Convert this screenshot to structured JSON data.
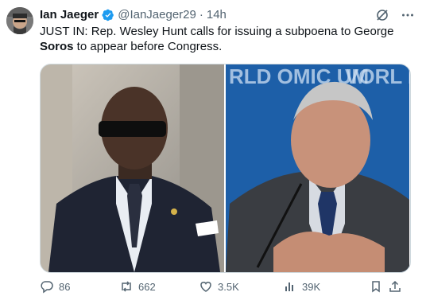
{
  "author": {
    "name": "Ian Jaeger",
    "handle": "@IanJaeger29",
    "separator": "·",
    "time": "14h",
    "verified_color": "#1d9bf0"
  },
  "post": {
    "text_prefix": "JUST IN: Rep. Wesley Hunt calls for issuing a subpoena to George ",
    "text_bold": "Soros",
    "text_suffix": " to appear before Congress."
  },
  "images": {
    "right_background_text": "RLD OMIC UM",
    "right_background_text_2": "VORL NOMI RU"
  },
  "actions": {
    "replies": "86",
    "reposts": "662",
    "likes": "3.5K",
    "views": "39K"
  },
  "icons": {
    "top": [
      "grok-icon",
      "more-icon"
    ],
    "bottom": [
      "reply-icon",
      "repost-icon",
      "like-icon",
      "views-icon",
      "bookmark-icon",
      "share-icon"
    ]
  }
}
